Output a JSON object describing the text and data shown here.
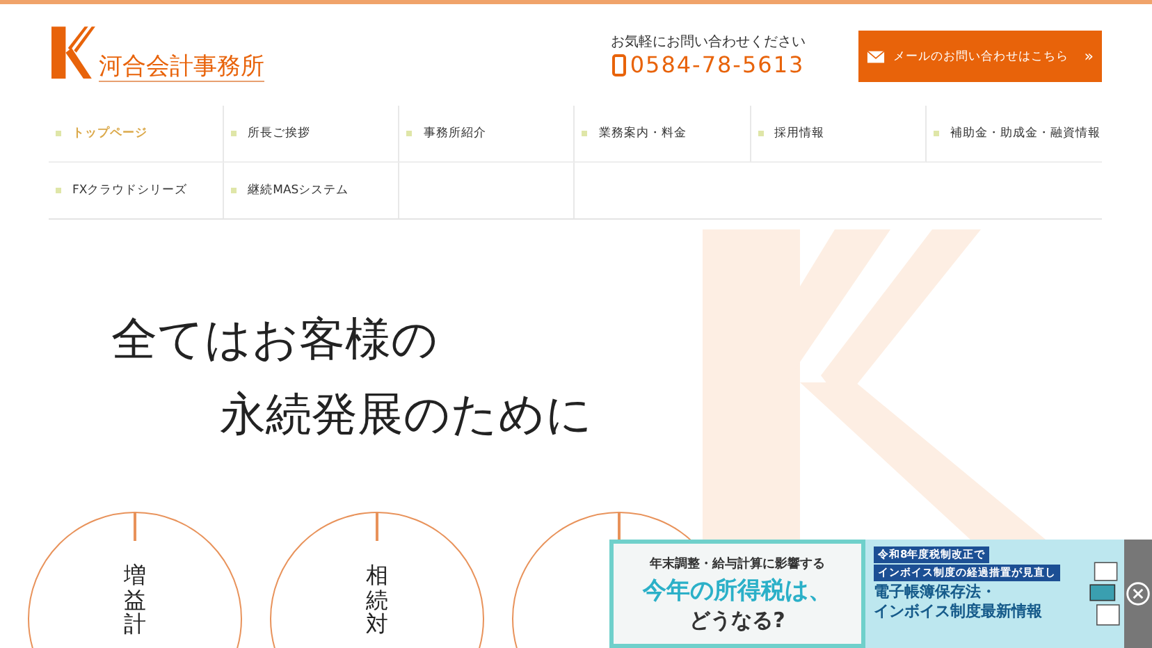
{
  "header": {
    "logo_text": "河合会計事務所",
    "contact_prompt": "お気軽にお問い合わせください",
    "phone": "0584-78-5613",
    "mail_button": "メールのお問い合わせはこちら",
    "mail_button_arrow": "»"
  },
  "nav": [
    {
      "label": "トップページ",
      "selected": true
    },
    {
      "label": "所長ご挨拶",
      "selected": false
    },
    {
      "label": "事務所紹介",
      "selected": false
    },
    {
      "label": "業務案内・料金",
      "selected": false
    },
    {
      "label": "採用情報",
      "selected": false
    },
    {
      "label": "補助金・助成金・融資情報",
      "selected": false
    },
    {
      "label": "FXクラウドシリーズ",
      "selected": false
    },
    {
      "label": "継続MASシステム",
      "selected": false
    }
  ],
  "hero": {
    "line_1": "全てはお客様の",
    "line_2": "永続発展のために"
  },
  "circles": [
    {
      "label": "増益計"
    },
    {
      "label": "相続対"
    }
  ],
  "banner": {
    "left_top": "年末調整・給与計算に影響する",
    "left_main": "今年の所得税は、",
    "left_sub": "どうなる?",
    "right_tag_1": "令和8年度税制改正で",
    "right_tag_2": "インボイス制度の経過措置が見直し",
    "right_main_1": "電子帳簿保存法・",
    "right_main_2": "インボイス制度最新情報"
  }
}
